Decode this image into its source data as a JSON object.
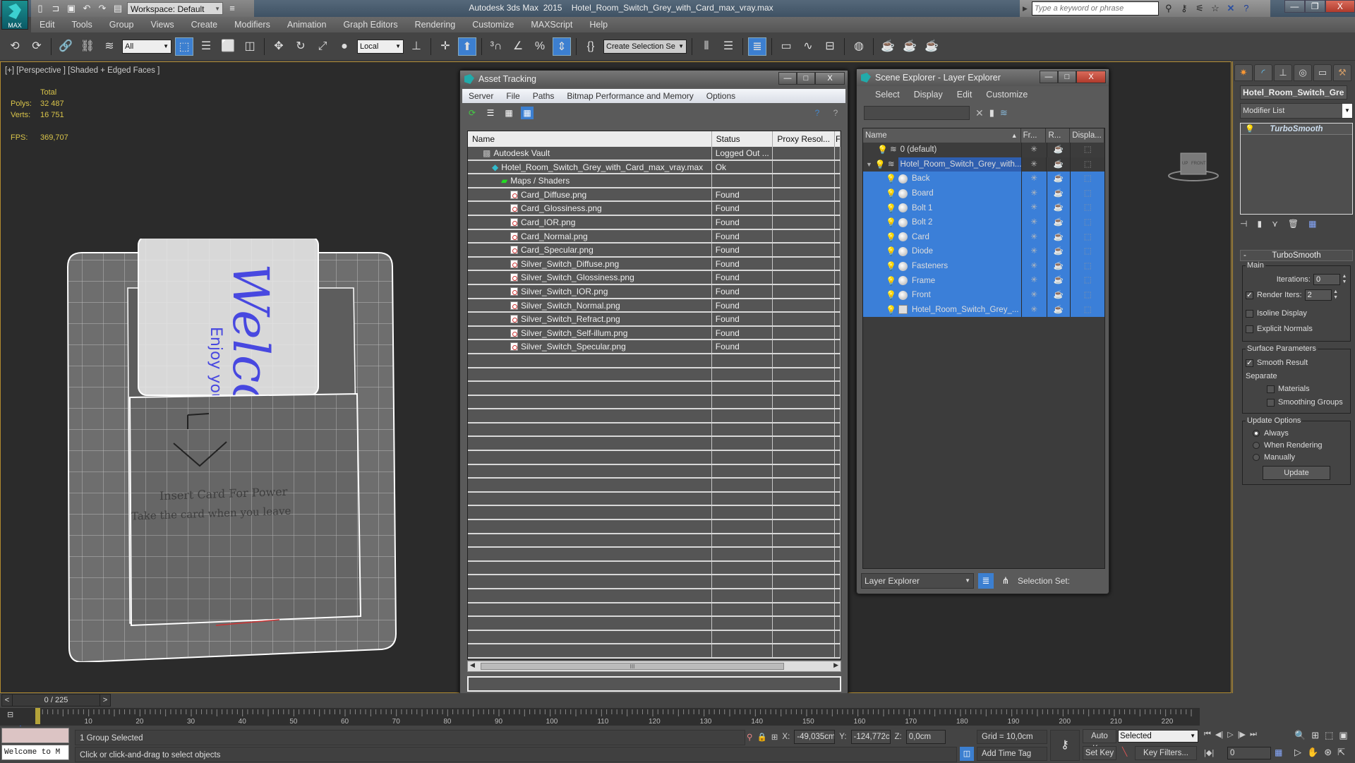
{
  "app": {
    "title": "Autodesk 3ds Max  2015",
    "file": "Hotel_Room_Switch_Grey_with_Card_max_vray.max",
    "logo_label": "MAX",
    "workspace": "Workspace: Default",
    "search_placeholder": "Type a keyword or phrase",
    "window_controls": {
      "minimize": "—",
      "maximize": "❐",
      "close": "X"
    }
  },
  "menu": [
    "Edit",
    "Tools",
    "Group",
    "Views",
    "Create",
    "Modifiers",
    "Animation",
    "Graph Editors",
    "Rendering",
    "Customize",
    "MAXScript",
    "Help"
  ],
  "toolbar": {
    "selection_filter": "All",
    "ref_coord": "Local",
    "selection_set": "Create Selection Se"
  },
  "viewport": {
    "label": "[+] [Perspective ] [Shaded + Edged Faces ]",
    "stats": {
      "header": "Total",
      "polys_label": "Polys:",
      "polys": "32 487",
      "verts_label": "Verts:",
      "verts": "16 751",
      "fps_label": "FPS:",
      "fps": "369,707"
    },
    "card_text_big": "Welco",
    "card_text_small": "Enjoy you",
    "switch_text_1": "Insert Card For Power",
    "switch_text_2": "Take the card when you leave",
    "viewcube_labels": {
      "up": "UP",
      "front": "FRONT"
    }
  },
  "asset_tracking": {
    "title": "Asset Tracking",
    "menu": [
      "Server",
      "File",
      "Paths",
      "Bitmap Performance and Memory",
      "Options"
    ],
    "columns": [
      "Name",
      "Status",
      "Proxy Resol...",
      "F"
    ],
    "rows": [
      {
        "name": "Autodesk Vault",
        "status": "Logged Out ...",
        "indent": 1,
        "icon": "vault-icon"
      },
      {
        "name": "Hotel_Room_Switch_Grey_with_Card_max_vray.max",
        "status": "Ok",
        "indent": 2,
        "icon": "max-file-icon"
      },
      {
        "name": "Maps / Shaders",
        "status": "",
        "indent": 3,
        "icon": "maps-icon"
      },
      {
        "name": "Card_Diffuse.png",
        "status": "Found",
        "indent": 4,
        "icon": "image-file-icon"
      },
      {
        "name": "Card_Glossiness.png",
        "status": "Found",
        "indent": 4,
        "icon": "image-file-icon"
      },
      {
        "name": "Card_IOR.png",
        "status": "Found",
        "indent": 4,
        "icon": "image-file-icon"
      },
      {
        "name": "Card_Normal.png",
        "status": "Found",
        "indent": 4,
        "icon": "image-file-icon"
      },
      {
        "name": "Card_Specular.png",
        "status": "Found",
        "indent": 4,
        "icon": "image-file-icon"
      },
      {
        "name": "Silver_Switch_Diffuse.png",
        "status": "Found",
        "indent": 4,
        "icon": "image-file-icon"
      },
      {
        "name": "Silver_Switch_Glossiness.png",
        "status": "Found",
        "indent": 4,
        "icon": "image-file-icon"
      },
      {
        "name": "Silver_Switch_IOR.png",
        "status": "Found",
        "indent": 4,
        "icon": "image-file-icon"
      },
      {
        "name": "Silver_Switch_Normal.png",
        "status": "Found",
        "indent": 4,
        "icon": "image-file-icon"
      },
      {
        "name": "Silver_Switch_Refract.png",
        "status": "Found",
        "indent": 4,
        "icon": "image-file-icon"
      },
      {
        "name": "Silver_Switch_Self-illum.png",
        "status": "Found",
        "indent": 4,
        "icon": "image-file-icon"
      },
      {
        "name": "Silver_Switch_Specular.png",
        "status": "Found",
        "indent": 4,
        "icon": "image-file-icon"
      }
    ],
    "empty_rows": 22,
    "scroll_thumb": "III"
  },
  "scene_explorer": {
    "title": "Scene Explorer - Layer Explorer",
    "menu": [
      "Select",
      "Display",
      "Edit",
      "Customize"
    ],
    "columns": [
      "Name",
      "Fr...",
      "R...",
      "Displa..."
    ],
    "layers": [
      {
        "name": "0 (default)",
        "type": "layer",
        "selected": false,
        "expanded": false
      },
      {
        "name": "Hotel_Room_Switch_Grey_with...",
        "type": "layer",
        "selected": true,
        "expanded": true
      }
    ],
    "objects": [
      "Back",
      "Board",
      "Bolt 1",
      "Bolt 2",
      "Card",
      "Diode",
      "Fasteners",
      "Frame",
      "Front",
      "Hotel_Room_Switch_Grey_..."
    ],
    "footer_mode": "Layer Explorer",
    "selection_set_label": "Selection Set:"
  },
  "command_panel": {
    "object_name": "Hotel_Room_Switch_Gre",
    "modifier_list": "Modifier List",
    "stack": [
      "TurboSmooth"
    ],
    "rollout_title": "TurboSmooth",
    "main_group": "Main",
    "iterations_label": "Iterations:",
    "iterations": "0",
    "render_iters_label": "Render Iters:",
    "render_iters": "2",
    "render_iters_checked": true,
    "isoline_label": "Isoline Display",
    "isoline_checked": false,
    "explicit_normals_label": "Explicit Normals",
    "explicit_normals_checked": false,
    "surface_group": "Surface Parameters",
    "smooth_result_label": "Smooth Result",
    "smooth_result_checked": true,
    "separate_label": "Separate",
    "materials_label": "Materials",
    "materials_checked": false,
    "smoothing_groups_label": "Smoothing Groups",
    "smoothing_groups_checked": false,
    "update_group": "Update Options",
    "update_options": [
      "Always",
      "When Rendering",
      "Manually"
    ],
    "update_selected": "Always",
    "update_button": "Update"
  },
  "timeline": {
    "current": "0 / 225",
    "frame_start": 0,
    "frame_end": 225,
    "ticks": [
      10,
      20,
      30,
      40,
      50,
      60,
      70,
      80,
      90,
      100,
      110,
      120,
      130,
      140,
      150,
      160,
      170,
      180,
      190,
      200,
      210,
      220
    ]
  },
  "status": {
    "welcome": "Welcome to M",
    "selection_info": "1 Group Selected",
    "prompt": "Click or click-and-drag to select objects",
    "x_label": "X:",
    "x": "-49,035cm",
    "y_label": "Y:",
    "y": "-124,772cm",
    "z_label": "Z:",
    "z": "0,0cm",
    "grid": "Grid = 10,0cm",
    "add_time_tag": "Add Time Tag",
    "auto_key": "Auto Key",
    "set_key": "Set Key",
    "key_mode": "Selected",
    "key_filters": "Key Filters...",
    "frame": "0"
  }
}
